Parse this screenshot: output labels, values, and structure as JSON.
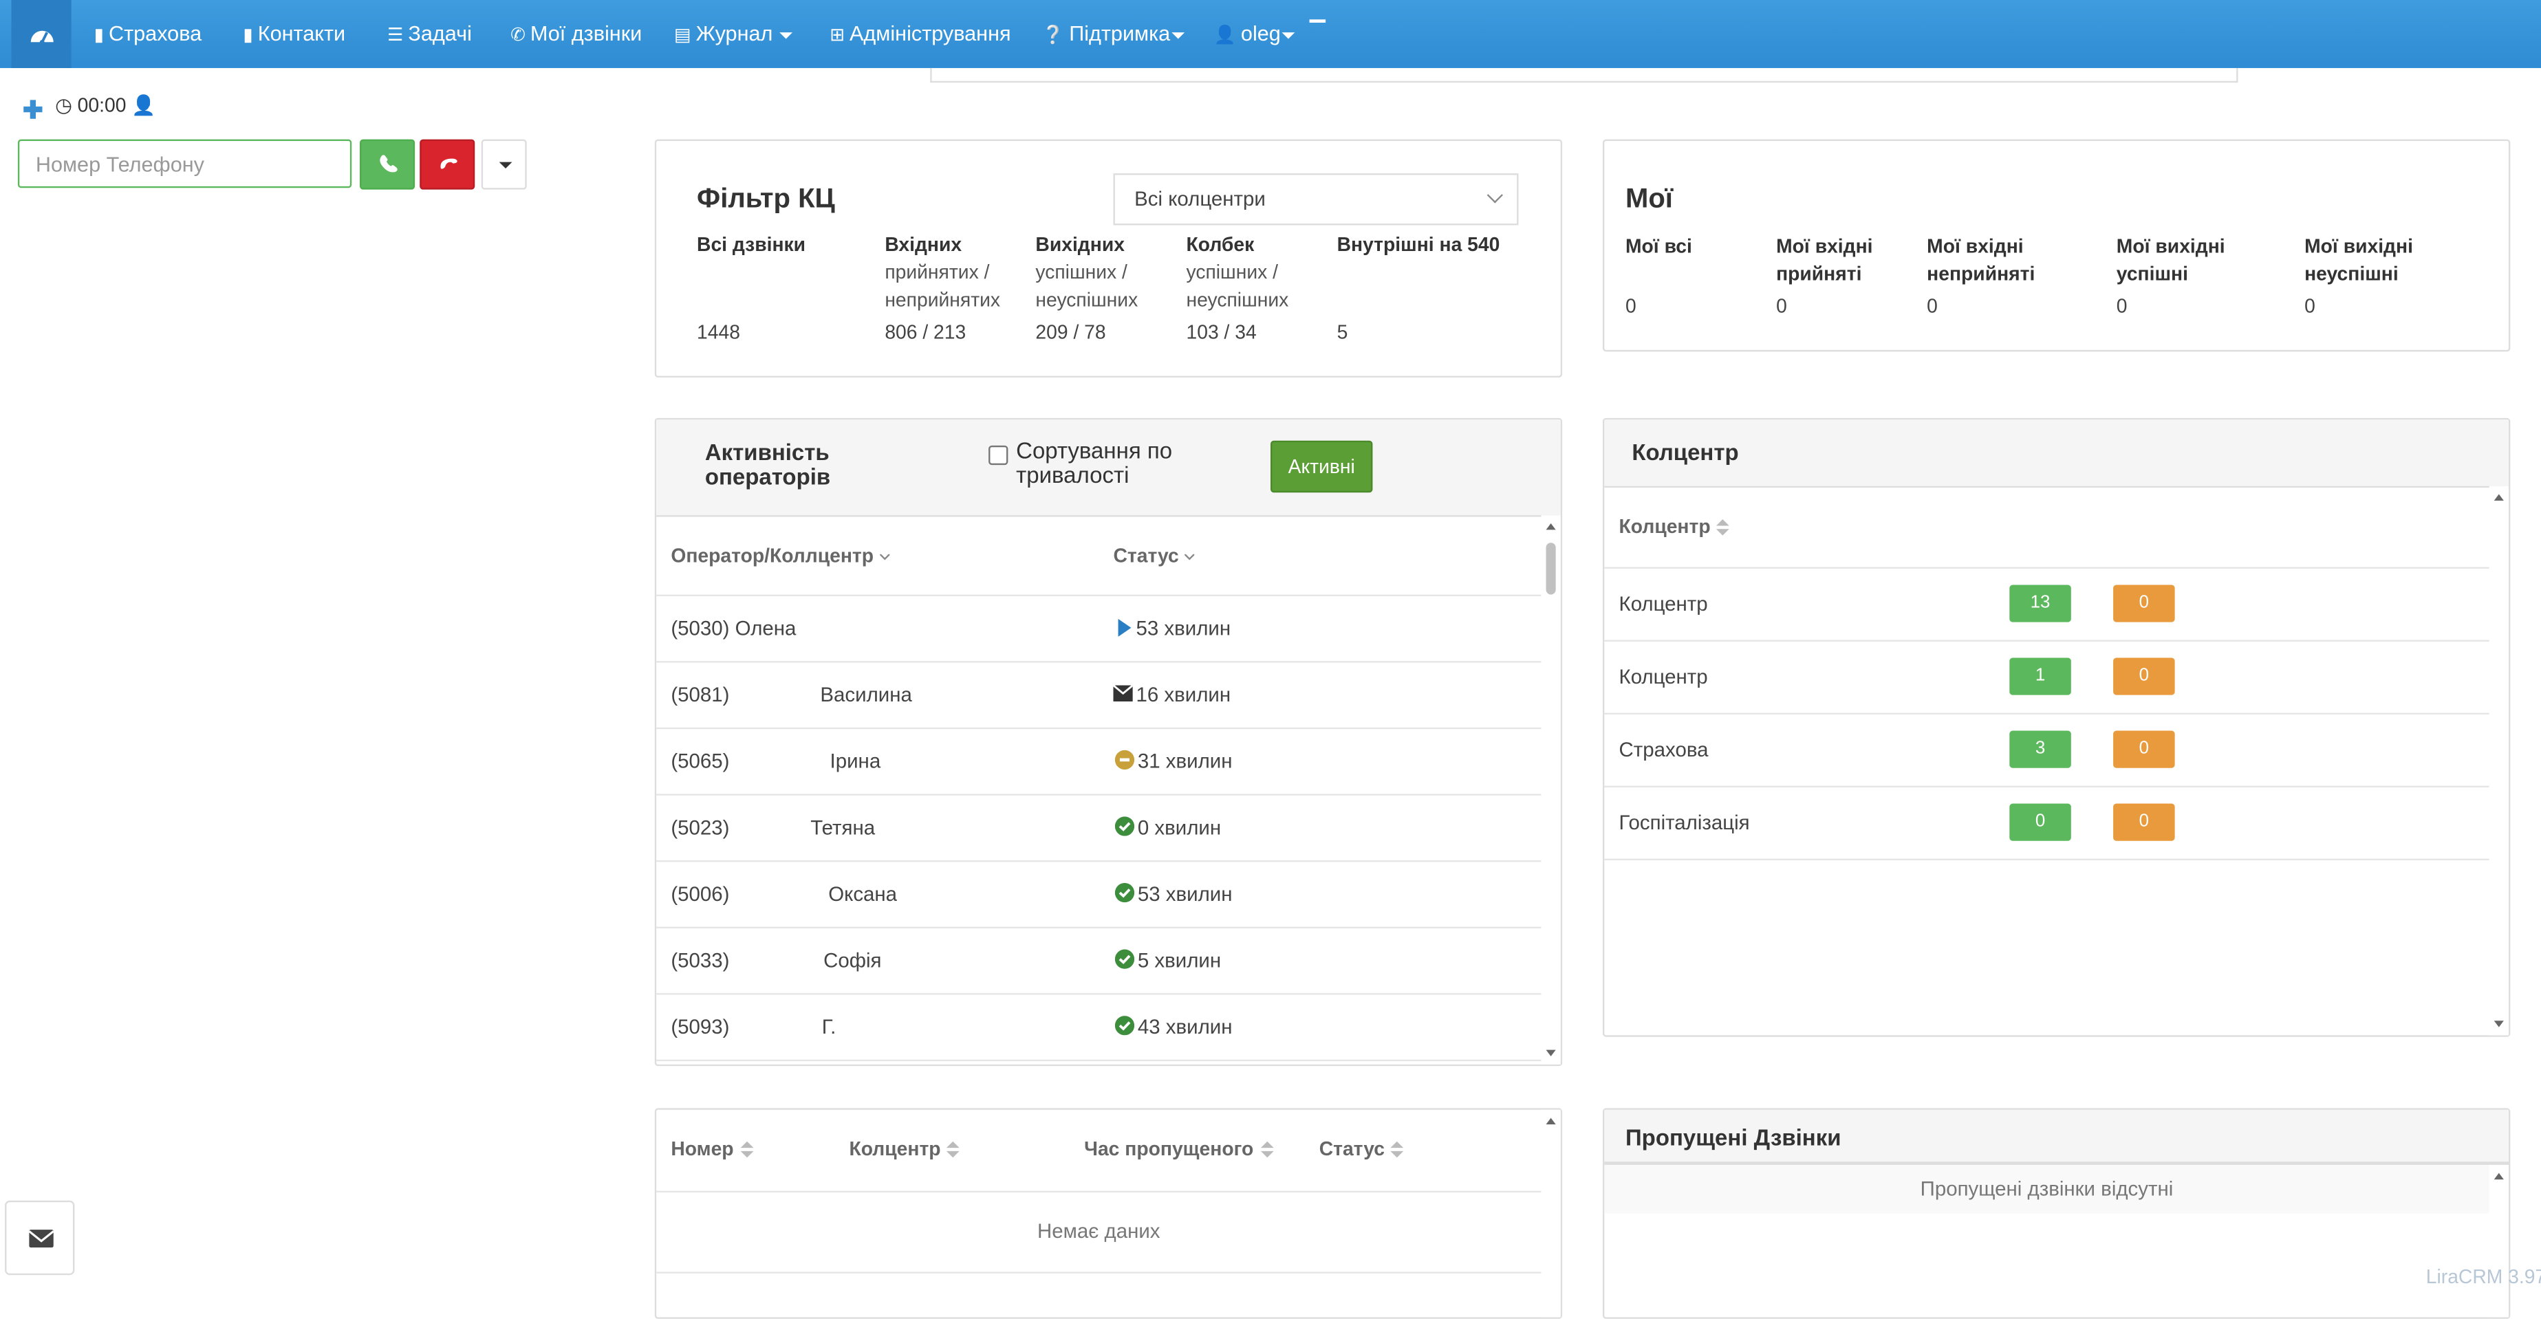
{
  "nav": {
    "items": [
      {
        "label": "Страхова",
        "icon": "file-icon"
      },
      {
        "label": "Контакти",
        "icon": "book-icon"
      },
      {
        "label": "Задачі",
        "icon": "tasks-icon"
      },
      {
        "label": "Мої дзвінки",
        "icon": "phone-icon"
      },
      {
        "label": "Журнал",
        "icon": "list-icon"
      },
      {
        "label": "Адміністрування",
        "icon": "plus-square-icon"
      },
      {
        "label": "Підтримка",
        "icon": "question-circle-icon"
      },
      {
        "label": "oleg",
        "icon": "user-icon"
      }
    ]
  },
  "phone": {
    "timer": "00:00",
    "placeholder": "Номер Телефону"
  },
  "filter": {
    "title": "Фільтр КЦ",
    "select_value": "Всі колцентри",
    "stats": [
      {
        "head": "Всі дзвінки",
        "sub": "",
        "value": "1448"
      },
      {
        "head": "Вхідних",
        "sub": "прийнятих / неприйнятих",
        "value": "806 / 213"
      },
      {
        "head": "Вихідних",
        "sub": "успішних / неуспішних",
        "value": "209 / 78"
      },
      {
        "head": "Колбек",
        "sub": "успішних / неуспішних",
        "value": "103 / 34"
      },
      {
        "head": "Внутрішні на 540",
        "sub": "",
        "value": "5"
      }
    ]
  },
  "mine": {
    "title": "Мої",
    "stats": [
      {
        "head": "Мої всі",
        "value": "0"
      },
      {
        "head": "Мої вхідні прийняті",
        "value": "0"
      },
      {
        "head": "Мої вхідні неприйняті",
        "value": "0"
      },
      {
        "head": "Мої вихідні успішні",
        "value": "0"
      },
      {
        "head": "Мої вихідні неуспішні",
        "value": "0"
      }
    ]
  },
  "operators": {
    "title": "Активність операторів",
    "sort_label": "Сортування по тривалості",
    "active_button": "Активні",
    "col_operator": "Оператор/Коллцентр",
    "col_status": "Статус",
    "rows": [
      {
        "ext": "(5030) Олена",
        "name": "",
        "status": "53 хвилин",
        "icon": "play-icon",
        "icon_color": "#2a7fc4"
      },
      {
        "ext": "(5081)",
        "name": "Василина",
        "status": "16 хвилин",
        "icon": "envelope-icon",
        "icon_color": "#333333"
      },
      {
        "ext": "(5065)",
        "name": "Ірина",
        "status": "31 хвилин",
        "icon": "minus-circle-icon",
        "icon_color": "#c9a13a"
      },
      {
        "ext": "(5023)",
        "name": "Тетяна",
        "status": "0 хвилин",
        "icon": "check-circle-icon",
        "icon_color": "#3c8d3c"
      },
      {
        "ext": "(5006)",
        "name": "Оксана",
        "status": "53 хвилин",
        "icon": "check-circle-icon",
        "icon_color": "#3c8d3c"
      },
      {
        "ext": "(5033)",
        "name": "Софія",
        "status": "5 хвилин",
        "icon": "check-circle-icon",
        "icon_color": "#3c8d3c"
      },
      {
        "ext": "(5093)",
        "name": "Г.",
        "status": "43 хвилин",
        "icon": "check-circle-icon",
        "icon_color": "#3c8d3c"
      }
    ]
  },
  "callcenter": {
    "title": "Колцентр",
    "col": "Колцентр",
    "rows": [
      {
        "name": "Колцентр",
        "green": "13",
        "orange": "0"
      },
      {
        "name": "Колцентр",
        "green": "1",
        "orange": "0"
      },
      {
        "name": "Страхова",
        "green": "3",
        "orange": "0"
      },
      {
        "name": "Госпіталізація",
        "green": "0",
        "orange": "0"
      }
    ]
  },
  "missed_table": {
    "cols": [
      "Номер",
      "Колцентр",
      "Час пропущеного",
      "Статус"
    ],
    "empty": "Немає даних"
  },
  "missed_panel": {
    "title": "Пропущені Дзвінки",
    "empty": "Пропущені дзвінки відсутні"
  },
  "footer": {
    "version": "LiraCRM 3.97"
  },
  "colors": {
    "navbar": "#2f8bd3",
    "success": "#5cb85c",
    "danger": "#d9232d",
    "warning": "#e89a3c",
    "active_button": "#5a9e35"
  }
}
